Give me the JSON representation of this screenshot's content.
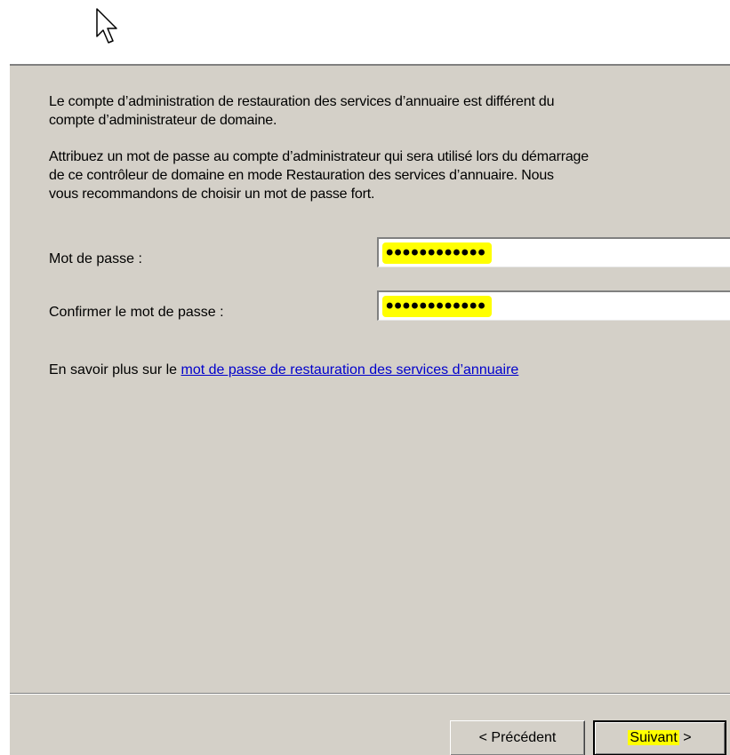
{
  "cursor": {
    "icon": "arrow-cursor-icon"
  },
  "dialog": {
    "paragraph1": {
      "line1": "Le compte d’administration de restauration des services d’annuaire est différent du",
      "line2": "compte d’administrateur de domaine."
    },
    "paragraph2": {
      "line1": "Attribuez un mot de passe au compte d’administrateur qui sera utilisé lors du démarrage",
      "line2": "de ce contrôleur de domaine en mode Restauration des services d’annuaire. Nous",
      "line3": "vous recommandons de choisir un mot de passe fort."
    },
    "password": {
      "label": "Mot de passe :",
      "masked_value": "••••••••••••"
    },
    "confirm_password": {
      "label": "Confirmer le mot de passe :",
      "masked_value": "••••••••••••"
    },
    "learn_more": {
      "prefix": "En savoir plus sur le",
      "link_text": "mot de passe de restauration des services d’annuaire"
    },
    "buttons": {
      "previous_label": "< Précédent",
      "next_label": "Suivant",
      "next_arrow": " >"
    }
  },
  "colors": {
    "dialog_background": "#d4d0c8",
    "highlight": "#ffff00",
    "link": "#0000cc"
  }
}
